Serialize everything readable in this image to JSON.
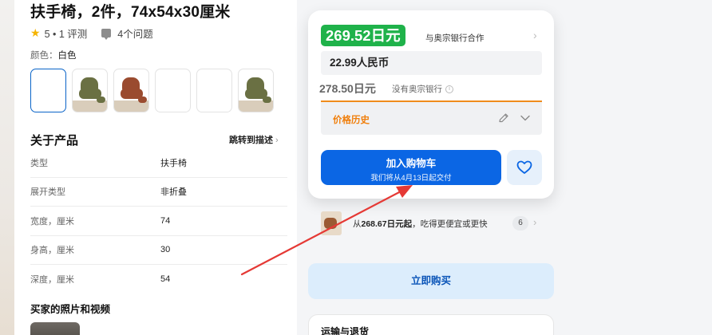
{
  "product": {
    "title": "扶手椅，2件，74x54x30厘米",
    "rating": "5 • 1 评测",
    "questions": "4个问题",
    "color_label": "颜色：",
    "color_value": "白色"
  },
  "about": {
    "heading": "关于产品",
    "jump_link": "跳转到描述",
    "specs": [
      {
        "key": "类型",
        "value": "扶手椅"
      },
      {
        "key": "展开类型",
        "value": "非折叠"
      },
      {
        "key": "宽度，厘米",
        "value": "74"
      },
      {
        "key": "身高，厘米",
        "value": "30"
      },
      {
        "key": "深度，厘米",
        "value": "54"
      }
    ]
  },
  "buyer": {
    "heading": "买家的照片和视频"
  },
  "pricing": {
    "bank_price": "269.52日元",
    "partner": "与奥宗银行合作",
    "rmb_price": "22.99人民币",
    "no_bank_price": "278.50日元",
    "no_bank_label": "没有奥宗银行",
    "history_label": "价格历史"
  },
  "actions": {
    "cart_label": "加入购物车",
    "cart_delivery": "我们将从4月13日起交付",
    "offers_prefix": "从",
    "offers_price": "268.67日元起",
    "offers_suffix": "，吃得更便宜或更快",
    "offers_count": "6",
    "buy_now": "立即购买",
    "shipping_title": "运输与退货"
  },
  "colors": {
    "accent": "#0b66e4",
    "price_badge": "#1fb24a",
    "history_accent": "#f07f0c",
    "annotation_arrow": "#e53935"
  }
}
